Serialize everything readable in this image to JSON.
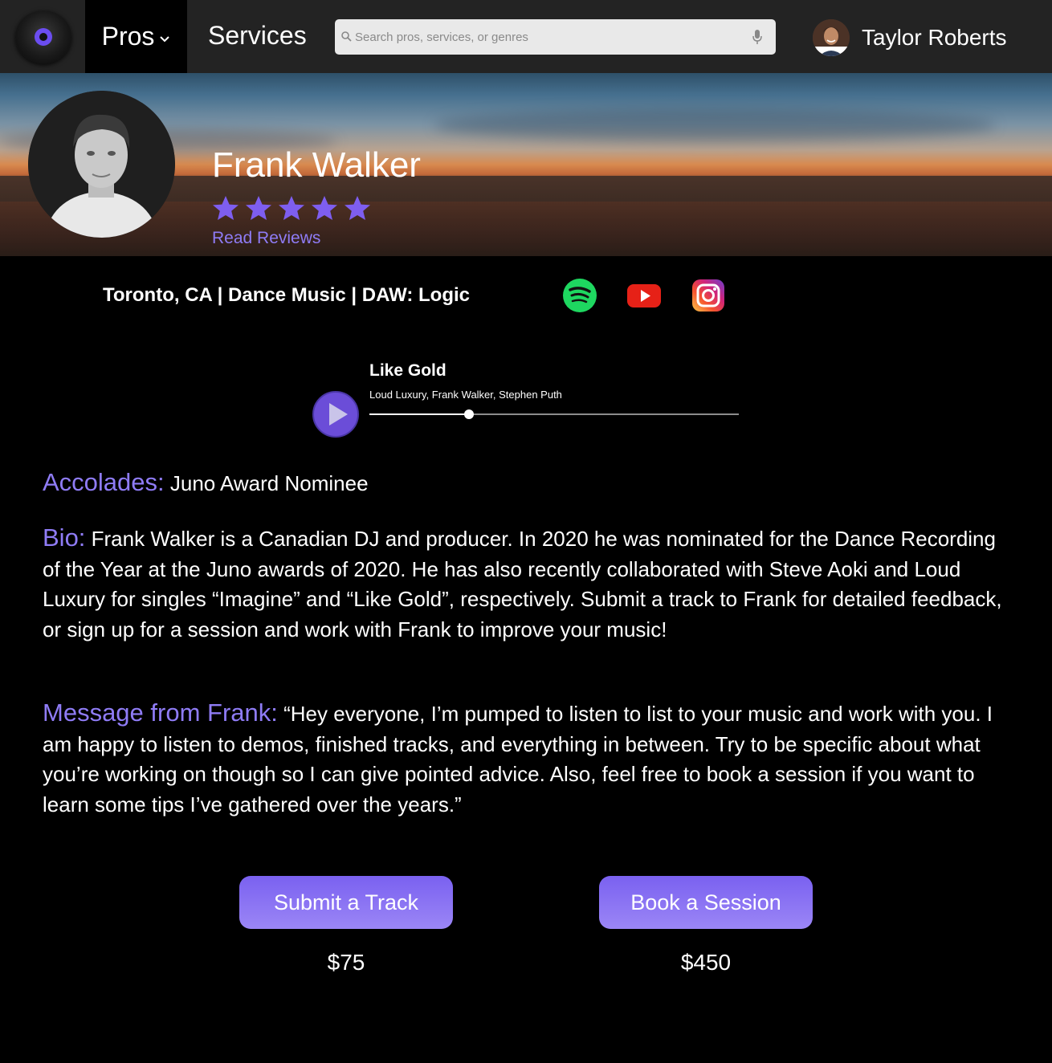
{
  "nav": {
    "pros_label": "Pros",
    "services_label": "Services",
    "search_placeholder": "Search pros, services, or genres",
    "user_name": "Taylor Roberts"
  },
  "profile": {
    "name": "Frank Walker",
    "rating": 5,
    "rating_max": 5,
    "reviews_link": "Read Reviews",
    "meta": "Toronto, CA | Dance Music | DAW: Logic",
    "social_icons": [
      "spotify-icon",
      "youtube-icon",
      "instagram-icon"
    ]
  },
  "player": {
    "title": "Like Gold",
    "artists": "Loud Luxury, Frank Walker, Stephen Puth",
    "progress_fraction": 0.27
  },
  "accolades": {
    "heading": "Accolades:",
    "text": " Juno Award Nominee"
  },
  "bio": {
    "heading": "Bio:",
    "text": " Frank Walker is a Canadian DJ and producer. In 2020 he was nominated for the Dance Recording of the Year at the Juno awards of 2020. He has also recently collaborated with Steve Aoki and Loud Luxury for singles “Imagine” and “Like Gold”, respectively. Submit a track to Frank for detailed feedback, or sign up for a session and work with Frank to improve your music!"
  },
  "message": {
    "heading": "Message from Frank:",
    "text": " “Hey everyone, I’m pumped to listen to list to your music and work with you. I am happy to listen to demos, finished tracks, and everything in between. Try to be specific about what you’re working on though so I can give pointed advice. Also, feel free to book a session if you want to learn some tips I’ve gathered over the years.”"
  },
  "actions": {
    "submit_label": "Submit a Track",
    "submit_price": "$75",
    "book_label": "Book a Session",
    "book_price": "$450"
  },
  "colors": {
    "accent": "#8f7cf6",
    "button": "#7a61f0",
    "nav_bg": "#232323",
    "page_bg": "#000000"
  }
}
